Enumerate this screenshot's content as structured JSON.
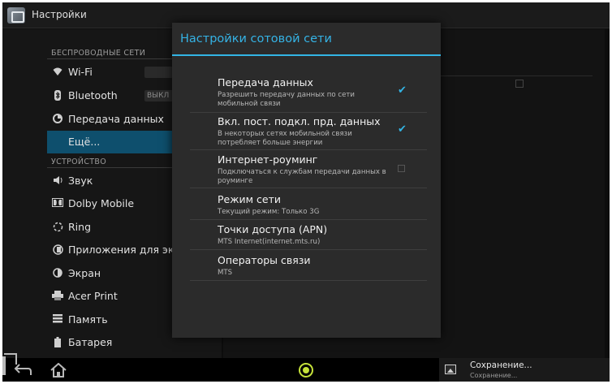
{
  "action_bar": {
    "title": "Настройки",
    "app_icon": "settings-app-icon"
  },
  "sidebar": {
    "sections": [
      {
        "header": "БЕСПРОВОДНЫЕ СЕТИ"
      },
      {
        "header": "УСТРОЙСТВО"
      }
    ],
    "items": [
      {
        "label": "Wi-Fi",
        "icon": "wifi-icon"
      },
      {
        "label": "Bluetooth",
        "icon": "bluetooth-icon",
        "toggle": "ВЫКЛ"
      },
      {
        "label": "Передача данных",
        "icon": "data-usage-icon"
      },
      {
        "label": "Ещё...",
        "selected": true
      },
      {
        "label": "Звук",
        "icon": "sound-icon"
      },
      {
        "label": "Dolby Mobile",
        "icon": "dolby-icon"
      },
      {
        "label": "Ring",
        "icon": "ring-icon"
      },
      {
        "label": "Приложения для экрана",
        "icon": "apps-icon"
      },
      {
        "label": "Экран",
        "icon": "display-icon"
      },
      {
        "label": "Acer Print",
        "icon": "print-icon"
      },
      {
        "label": "Память",
        "icon": "storage-icon"
      },
      {
        "label": "Батарея",
        "icon": "battery-icon"
      }
    ]
  },
  "dialog": {
    "title": "Настройки сотовой сети",
    "accent_color": "#33b5e5",
    "prefs": [
      {
        "title": "Передача данных",
        "summary": "Разрешить передачу данных по сети мобильной связи",
        "checked": true
      },
      {
        "title": "Вкл. пост. подкл. прд. данных",
        "summary": "В некоторых сетях мобильной связи потребляет больше энергии",
        "checked": true
      },
      {
        "title": "Интернет-роуминг",
        "summary": "Подключаться к службам передачи данных в роуминге",
        "checked": false
      },
      {
        "title": "Режим сети",
        "summary": "Текущий режим: Только 3G"
      },
      {
        "title": "Точки доступа (APN)",
        "summary": "MTS Internet(internet.mts.ru)"
      },
      {
        "title": "Операторы связи",
        "summary": "MTS"
      }
    ]
  },
  "navbar": {
    "icons": [
      "back-icon",
      "home-icon",
      "recents-icon",
      "status-app-icon"
    ],
    "notification": {
      "title": "Сохранение...",
      "subtitle": "Сохранение...",
      "icon": "image-icon"
    }
  }
}
